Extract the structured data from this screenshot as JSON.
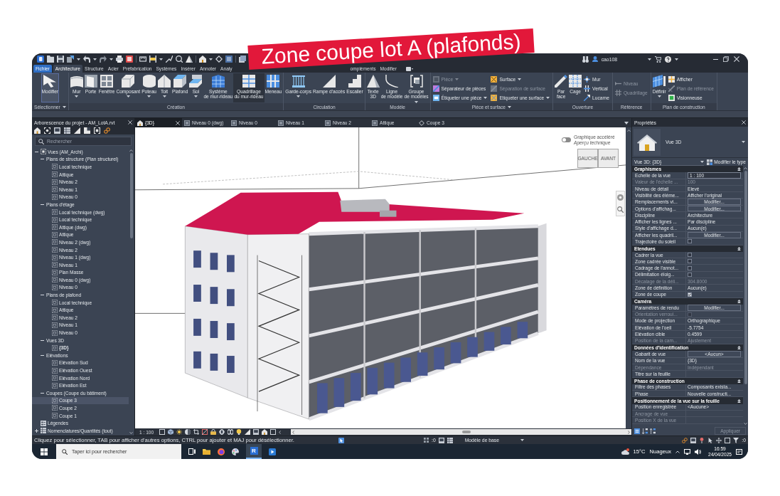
{
  "caption": {
    "text": "Zone coupe lot A (plafonds)"
  },
  "title_bar": {
    "user": "cao108"
  },
  "ribbon": {
    "tabs": [
      {
        "label": "Fichier",
        "kind": "file",
        "selected": false
      },
      {
        "label": "Architecture",
        "kind": "tab",
        "selected": true
      },
      {
        "label": "Structure",
        "kind": "tab",
        "selected": false
      },
      {
        "label": "Acier",
        "kind": "tab",
        "selected": false
      },
      {
        "label": "Préfabrication",
        "kind": "tab",
        "selected": false
      },
      {
        "label": "Systèmes",
        "kind": "tab",
        "selected": false
      },
      {
        "label": "Insérer",
        "kind": "tab",
        "selected": false
      },
      {
        "label": "Annoter",
        "kind": "tab",
        "selected": false
      },
      {
        "label": "Analy",
        "kind": "clipped",
        "selected": false
      },
      {
        "label": "ompléments",
        "kind": "tab",
        "selected": false
      },
      {
        "label": "Modifier",
        "kind": "tab",
        "selected": false
      }
    ],
    "panels": [
      {
        "title": "Sélectionner",
        "menu": true,
        "tools": [
          {
            "label": "Modifier",
            "kind": "large",
            "selected": true,
            "highlighted": false,
            "disabled": false,
            "menu": false
          }
        ]
      },
      {
        "title": "Création",
        "menu": false,
        "tools": [
          {
            "label": "Mur",
            "kind": "large",
            "selected": false,
            "highlighted": false,
            "disabled": false,
            "menu": true
          },
          {
            "label": "Porte",
            "kind": "large",
            "selected": false,
            "highlighted": false,
            "disabled": false,
            "menu": false
          },
          {
            "label": "Fenêtre",
            "kind": "large",
            "selected": false,
            "highlighted": false,
            "disabled": false,
            "menu": false
          },
          {
            "label": "Composant",
            "kind": "large",
            "selected": false,
            "highlighted": false,
            "disabled": false,
            "menu": true
          },
          {
            "label": "Poteau",
            "kind": "large",
            "selected": false,
            "highlighted": false,
            "disabled": false,
            "menu": true
          },
          {
            "label": "Toit",
            "kind": "large",
            "selected": false,
            "highlighted": false,
            "disabled": false,
            "menu": true
          },
          {
            "label": "Plafond",
            "kind": "large",
            "selected": false,
            "highlighted": false,
            "disabled": false,
            "menu": false
          },
          {
            "label": "Sol",
            "kind": "large",
            "selected": false,
            "highlighted": false,
            "disabled": false,
            "menu": true
          },
          {
            "label": "Système\nde mur-rideau",
            "kind": "large",
            "selected": false,
            "highlighted": false,
            "disabled": false,
            "menu": false
          },
          {
            "label": "Quadrillage\ndu mur-rideau",
            "kind": "large",
            "selected": false,
            "highlighted": true,
            "disabled": false,
            "menu": false
          },
          {
            "label": "Meneau",
            "kind": "large",
            "selected": false,
            "highlighted": false,
            "disabled": false,
            "menu": false
          }
        ]
      },
      {
        "title": "Circulation",
        "menu": false,
        "tools": [
          {
            "label": "Garde-corps",
            "kind": "large",
            "selected": false,
            "highlighted": false,
            "disabled": false,
            "menu": true
          },
          {
            "label": "Rampe d'accès",
            "kind": "large",
            "selected": false,
            "highlighted": false,
            "disabled": false,
            "menu": false
          },
          {
            "label": "Escalier",
            "kind": "large",
            "selected": false,
            "highlighted": false,
            "disabled": false,
            "menu": false
          }
        ]
      },
      {
        "title": "Modèle",
        "menu": false,
        "tools": [
          {
            "label": "Texte\n3D",
            "kind": "large",
            "selected": false,
            "highlighted": false,
            "disabled": false,
            "menu": false
          },
          {
            "label": "Ligne\nde modèle",
            "kind": "large",
            "selected": false,
            "highlighted": false,
            "disabled": false,
            "menu": false
          },
          {
            "label": "Groupe\nde modèles",
            "kind": "large",
            "selected": false,
            "highlighted": false,
            "disabled": false,
            "menu": true
          }
        ]
      },
      {
        "title": "Pièce et surface",
        "menu": true,
        "tools": [
          {
            "label": "Pièce",
            "kind": "small",
            "selected": false,
            "highlighted": false,
            "disabled": true,
            "menu": true
          },
          {
            "label": "Séparateur de pièces",
            "kind": "small",
            "selected": false,
            "highlighted": false,
            "disabled": false,
            "menu": false
          },
          {
            "label": "Étiqueter une pièce",
            "kind": "small",
            "selected": false,
            "highlighted": false,
            "disabled": false,
            "menu": true
          },
          {
            "label": "Surface",
            "kind": "small",
            "selected": false,
            "highlighted": false,
            "disabled": false,
            "menu": true
          },
          {
            "label": "Séparation de surface",
            "kind": "small",
            "selected": false,
            "highlighted": false,
            "disabled": true,
            "menu": false
          },
          {
            "label": "Etiqueter une surface",
            "kind": "small",
            "selected": false,
            "highlighted": false,
            "disabled": false,
            "menu": true
          }
        ]
      },
      {
        "title": "Ouverture",
        "menu": false,
        "tools": [
          {
            "label": "Par\nface",
            "kind": "large",
            "selected": false,
            "highlighted": false,
            "disabled": false,
            "menu": false
          },
          {
            "label": "Cage",
            "kind": "large",
            "selected": false,
            "highlighted": false,
            "disabled": false,
            "menu": false
          },
          {
            "label": "Mur",
            "kind": "small",
            "selected": false,
            "highlighted": false,
            "disabled": false,
            "menu": false
          },
          {
            "label": "Vertical",
            "kind": "small",
            "selected": false,
            "highlighted": false,
            "disabled": false,
            "menu": false
          },
          {
            "label": "Lucarne",
            "kind": "small",
            "selected": false,
            "highlighted": false,
            "disabled": false,
            "menu": false
          }
        ]
      },
      {
        "title": "Référence",
        "menu": false,
        "tools": [
          {
            "label": "Niveau",
            "kind": "small",
            "selected": false,
            "highlighted": false,
            "disabled": true,
            "menu": false
          },
          {
            "label": "Quadrillage",
            "kind": "small",
            "selected": false,
            "highlighted": false,
            "disabled": true,
            "menu": false
          }
        ]
      },
      {
        "title": "Plan de construction",
        "menu": false,
        "tools": [
          {
            "label": "Définir",
            "kind": "large",
            "selected": false,
            "highlighted": false,
            "disabled": false,
            "menu": true
          },
          {
            "label": "Afficher",
            "kind": "small",
            "selected": false,
            "highlighted": false,
            "disabled": false,
            "menu": false
          },
          {
            "label": "Plan de référence",
            "kind": "small",
            "selected": false,
            "highlighted": false,
            "disabled": true,
            "menu": false
          },
          {
            "label": "Visionneuse",
            "kind": "small",
            "selected": false,
            "highlighted": false,
            "disabled": false,
            "menu": false
          }
        ]
      }
    ]
  },
  "project_browser": {
    "title": "Arborescence du projet - AM_LotA.rvt",
    "search": {
      "placeholder": "Rechercher"
    },
    "tree": [
      {
        "label": "Vues (AM_Archi)",
        "kind": "views",
        "expanded": true,
        "selected": false,
        "children": [
          {
            "label": "Plans de structure (Plan structurel)",
            "expanded": true,
            "selected": false,
            "children": [
              {
                "label": "Local technique",
                "kind": "view",
                "selected": false
              },
              {
                "label": "Attique",
                "kind": "view",
                "selected": false
              },
              {
                "label": "Niveau 2",
                "kind": "view",
                "selected": false
              },
              {
                "label": "Niveau 1",
                "kind": "view",
                "selected": false
              },
              {
                "label": "Niveau 0",
                "kind": "view",
                "selected": false
              }
            ]
          },
          {
            "label": "Plans d'étage",
            "expanded": true,
            "selected": false,
            "children": [
              {
                "label": "Local technique (dwg)",
                "kind": "view",
                "selected": false
              },
              {
                "label": "Local technique",
                "kind": "view",
                "selected": false
              },
              {
                "label": "Attique (dwg)",
                "kind": "view",
                "selected": false
              },
              {
                "label": "Attique",
                "kind": "view",
                "selected": false
              },
              {
                "label": "Niveau 2 (dwg)",
                "kind": "view",
                "selected": false
              },
              {
                "label": "Niveau 2",
                "kind": "view",
                "selected": false
              },
              {
                "label": "Niveau 1 (dwg)",
                "kind": "view",
                "selected": false
              },
              {
                "label": "Niveau 1",
                "kind": "view",
                "selected": false
              },
              {
                "label": "Plan Masse",
                "kind": "view",
                "selected": false
              },
              {
                "label": "Niveau 0 (dwg)",
                "kind": "view",
                "selected": false
              },
              {
                "label": "Niveau 0",
                "kind": "view",
                "selected": false
              }
            ]
          },
          {
            "label": "Plans de plafond",
            "expanded": true,
            "selected": false,
            "children": [
              {
                "label": "Local technique",
                "kind": "view",
                "selected": false
              },
              {
                "label": "Attique",
                "kind": "view",
                "selected": false
              },
              {
                "label": "Niveau 2",
                "kind": "view",
                "selected": false
              },
              {
                "label": "Niveau 1",
                "kind": "view",
                "selected": false
              },
              {
                "label": "Niveau 0",
                "kind": "view",
                "selected": false
              }
            ]
          },
          {
            "label": "Vues 3D",
            "expanded": true,
            "selected": false,
            "children": [
              {
                "label": "{3D}",
                "kind": "view",
                "selected": false,
                "active": true
              }
            ]
          },
          {
            "label": "Elévations",
            "expanded": true,
            "selected": false,
            "children": [
              {
                "label": "Elévation Sud",
                "kind": "view",
                "selected": false
              },
              {
                "label": "Elévation Ouest",
                "kind": "view",
                "selected": false
              },
              {
                "label": "Elévation Nord",
                "kind": "view",
                "selected": false
              },
              {
                "label": "Elévation Est",
                "kind": "view",
                "selected": false
              }
            ]
          },
          {
            "label": "Coupes (Coupe du bâtiment)",
            "expanded": true,
            "selected": false,
            "children": [
              {
                "label": "Coupe 3",
                "kind": "view",
                "selected": true
              },
              {
                "label": "Coupe 2",
                "kind": "view",
                "selected": false
              },
              {
                "label": "Coupe 1",
                "kind": "view",
                "selected": false
              }
            ]
          }
        ]
      },
      {
        "label": "Légendes",
        "kind": "legends",
        "selected": false
      },
      {
        "label": "Nomenclatures/Quantités (tout)",
        "kind": "schedules",
        "expanded": false,
        "selected": false
      }
    ]
  },
  "view_tabs": [
    {
      "label": "{3D}",
      "kind": "model",
      "selected": true
    },
    {
      "label": "Niveau 0 (dwg)",
      "kind": "plan",
      "selected": false
    },
    {
      "label": "Niveau 0",
      "kind": "plan",
      "selected": false
    },
    {
      "label": "Niveau 1",
      "kind": "plan",
      "selected": false
    },
    {
      "label": "Niveau 2",
      "kind": "plan",
      "selected": false
    },
    {
      "label": "Attique",
      "kind": "plan",
      "selected": false
    },
    {
      "label": "Coupe 3",
      "kind": "section",
      "selected": false
    }
  ],
  "viewport": {
    "graphics_toggle": {
      "on": false,
      "label": "Graphique accéléré",
      "sublabel": "Aperçu technique"
    },
    "viewcube": {
      "left_face": "GAUCHE",
      "front_face": "AVANT"
    },
    "scale": "1 : 100"
  },
  "properties": {
    "title": "Propriétés",
    "type_name": "Vue 3D",
    "instance_selector": "Vue 3D: {3D}",
    "edit_type": "Modifier le type",
    "groups": [
      {
        "title": "Graphismes",
        "expanded": true,
        "rows": [
          {
            "label": "Echelle de la vue",
            "kind": "field",
            "value": "1 : 100",
            "disabled": false
          },
          {
            "label": "Valeur de l'échelle ...",
            "kind": "text",
            "value": "100",
            "disabled": true
          },
          {
            "label": "Niveau de détail",
            "kind": "text",
            "value": "Elevé",
            "disabled": false
          },
          {
            "label": "Visibilité des éléme...",
            "kind": "text",
            "value": "Afficher l'original",
            "disabled": false
          },
          {
            "label": "Remplacements vi...",
            "kind": "button",
            "value": "Modifier...",
            "disabled": false
          },
          {
            "label": "Options d'affichag...",
            "kind": "button",
            "value": "Modifier...",
            "disabled": false
          },
          {
            "label": "Discipline",
            "kind": "text",
            "value": "Architecture",
            "disabled": false
          },
          {
            "label": "Afficher les lignes ...",
            "kind": "text",
            "value": "Par discipline",
            "disabled": false
          },
          {
            "label": "Style d'affichage d...",
            "kind": "text",
            "value": "Aucun(e)",
            "disabled": false
          },
          {
            "label": "Afficher les quadril...",
            "kind": "button",
            "value": "Modifier...",
            "disabled": false
          },
          {
            "label": "Trajectoire du soleil",
            "kind": "checkbox",
            "checked": false,
            "disabled": false
          }
        ]
      },
      {
        "title": "Etendues",
        "expanded": true,
        "rows": [
          {
            "label": "Cadrer la vue",
            "kind": "checkbox",
            "checked": false,
            "disabled": false
          },
          {
            "label": "Zone cadrée visible",
            "kind": "checkbox",
            "checked": false,
            "disabled": false
          },
          {
            "label": "Cadrage de l'annot...",
            "kind": "checkbox",
            "checked": false,
            "disabled": false
          },
          {
            "label": "Délimitation éloig...",
            "kind": "checkbox",
            "checked": false,
            "disabled": false
          },
          {
            "label": "Décalage de la déli...",
            "kind": "text",
            "value": "304.8000",
            "disabled": true
          },
          {
            "label": "Zone de définition",
            "kind": "text",
            "value": "Aucun(e)",
            "disabled": false
          },
          {
            "label": "Zone de coupe",
            "kind": "checkbox",
            "checked": true,
            "disabled": false
          }
        ]
      },
      {
        "title": "Caméra",
        "expanded": true,
        "rows": [
          {
            "label": "Paramètres de rendu",
            "kind": "button",
            "value": "Modifier...",
            "disabled": false
          },
          {
            "label": "Orientation verroui...",
            "kind": "checkbox",
            "checked": false,
            "disabled": true
          },
          {
            "label": "Mode de projection",
            "kind": "text",
            "value": "Orthographique",
            "disabled": false
          },
          {
            "label": "Elévation de l'oeil",
            "kind": "text",
            "value": "-5.7754",
            "disabled": false
          },
          {
            "label": "Elévation cible",
            "kind": "text",
            "value": "0.4599",
            "disabled": false
          },
          {
            "label": "Position de la cam...",
            "kind": "text",
            "value": "Ajustement",
            "disabled": true
          }
        ]
      },
      {
        "title": "Données d'identification",
        "expanded": true,
        "rows": [
          {
            "label": "Gabarit de vue",
            "kind": "button",
            "value": "<Aucun>",
            "disabled": false
          },
          {
            "label": "Nom de la vue",
            "kind": "text",
            "value": "{3D}",
            "disabled": false
          },
          {
            "label": "Dépendance",
            "kind": "text",
            "value": "Indépendant",
            "disabled": true
          },
          {
            "label": "Titre sur la feuille",
            "disabled": false
          }
        ]
      },
      {
        "title": "Phase de construction",
        "expanded": true,
        "rows": [
          {
            "label": "Filtre des phases",
            "kind": "text",
            "value": "Composants exista...",
            "disabled": false
          },
          {
            "label": "Phase",
            "kind": "text",
            "value": "Nouvelle constructi...",
            "disabled": false
          }
        ]
      },
      {
        "title": "Positionnement de la vue sur la feuille",
        "expanded": true,
        "rows": [
          {
            "label": "Position enregistrée",
            "kind": "text",
            "value": "<Aucune>",
            "disabled": false
          },
          {
            "label": "Ancrage de vue",
            "disabled": true
          },
          {
            "label": "Position X de la vue",
            "disabled": true
          }
        ]
      }
    ],
    "apply": {
      "label": "Appliquer",
      "disabled": true
    }
  },
  "status_bar": {
    "message": "Cliquez pour sélectionner, TAB pour afficher d'autres options, CTRL pour ajouter et MAJ pour désélectionner.",
    "count": ":0",
    "model": "Modèle de base",
    "filter_count": ":0"
  },
  "taskbar": {
    "search": {
      "placeholder": "Taper ici pour rechercher"
    },
    "app_badge": "R",
    "temperature": "15°C",
    "weather": "Nuageux",
    "time": "16:59",
    "date": "24/04/2025"
  }
}
